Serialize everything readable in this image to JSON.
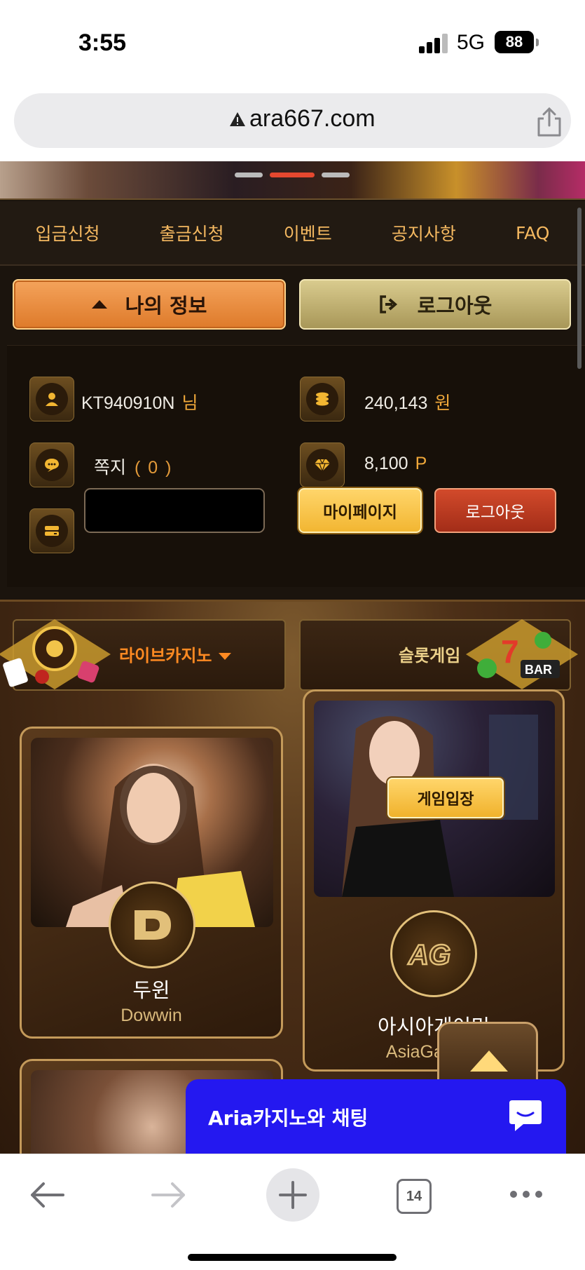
{
  "status_bar": {
    "time": "3:55",
    "network": "5G",
    "battery": "88"
  },
  "browser": {
    "url": "ara667.com",
    "tab_count": "14"
  },
  "nav": {
    "items": [
      "입금신청",
      "출금신청",
      "이벤트",
      "공지사항",
      "FAQ"
    ]
  },
  "actions": {
    "my_info": "나의 정보",
    "logout": "로그아웃"
  },
  "account": {
    "user_id": "KT940910N",
    "user_suffix": "님",
    "balance": "240,143",
    "balance_unit": "원",
    "message_label": "쪽지",
    "message_count": "( 0 )",
    "points": "8,100",
    "points_unit": "P",
    "mypage_button": "마이페이지",
    "logout_button": "로그아웃"
  },
  "categories": {
    "live": "라이브카지노",
    "slot": "슬롯게임"
  },
  "providers": [
    {
      "name": "두윈",
      "sub": "Dowwin"
    },
    {
      "name": "아시아게이밍",
      "sub": "AsiaGaming",
      "enter_label": "게임입장"
    }
  ],
  "chat": {
    "label": "Aria카지노와 채팅"
  },
  "colors": {
    "accent_orange": "#f09a45",
    "gold": "#f2c44a",
    "chat_blue": "#2418f0",
    "bg_dark": "#1b140d"
  }
}
